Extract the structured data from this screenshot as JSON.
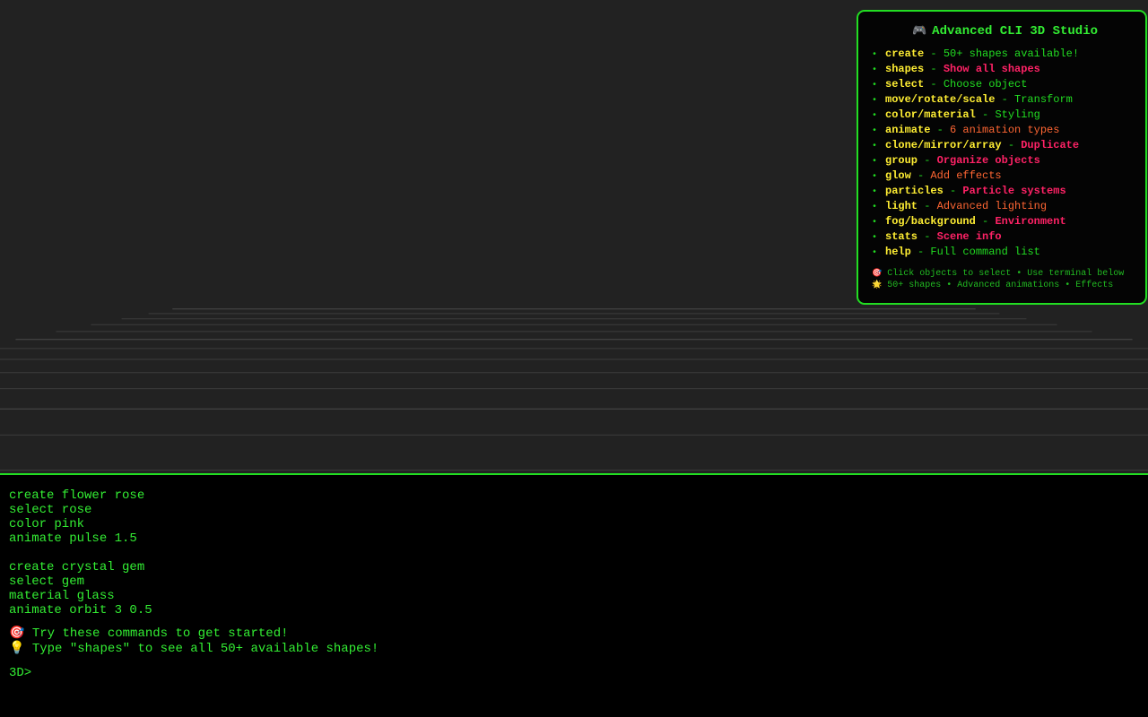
{
  "help": {
    "icon": "gamepad-icon",
    "title": "Advanced CLI 3D Studio",
    "commands": [
      {
        "cmd": "create",
        "desc": "50+ shapes available!",
        "color": "#22dd22"
      },
      {
        "cmd": "shapes",
        "desc": "Show all shapes",
        "color": "#ff2266"
      },
      {
        "cmd": "select",
        "desc": "Choose object",
        "color": "#22dd22"
      },
      {
        "cmd": "move/rotate/scale",
        "desc": "Transform",
        "color": "#22dd22"
      },
      {
        "cmd": "color/material",
        "desc": "Styling",
        "color": "#22dd22"
      },
      {
        "cmd": "animate",
        "desc": "6 animation types",
        "color": "#ff6633"
      },
      {
        "cmd": "clone/mirror/array",
        "desc": "Duplicate",
        "color": "#ff2266"
      },
      {
        "cmd": "group",
        "desc": "Organize objects",
        "color": "#ff2266"
      },
      {
        "cmd": "glow",
        "desc": "Add effects",
        "color": "#ff6633"
      },
      {
        "cmd": "particles",
        "desc": "Particle systems",
        "color": "#ff2266"
      },
      {
        "cmd": "light",
        "desc": "Advanced lighting",
        "color": "#ff6633"
      },
      {
        "cmd": "fog/background",
        "desc": "Environment",
        "color": "#ff2266"
      },
      {
        "cmd": "stats",
        "desc": "Scene info",
        "color": "#ff2266"
      },
      {
        "cmd": "help",
        "desc": "Full command list",
        "color": "#22dd22"
      }
    ],
    "footer_line1_icon": "target-icon",
    "footer_line1": "Click objects to select • Use terminal below",
    "footer_line2_icon": "star-icon",
    "footer_line2": "50+ shapes • Advanced animations • Effects"
  },
  "terminal": {
    "block1": [
      "create flower rose",
      "select rose",
      "color pink",
      "animate pulse 1.5"
    ],
    "block2": [
      "create crystal gem",
      "select gem",
      "material glass",
      "animate orbit 3 0.5"
    ],
    "tip1_icon": "target-icon",
    "tip1": "Try these commands to get started!",
    "tip2_icon": "lightbulb-icon",
    "tip2": "Type \"shapes\" to see all 50+ available shapes!",
    "prompt": "3D>",
    "input_value": ""
  },
  "colors": {
    "accent": "#22dd22",
    "command": "#ffee33",
    "highlight": "#ff2266",
    "secondary": "#ff6633",
    "viewport_bg": "#222222"
  }
}
